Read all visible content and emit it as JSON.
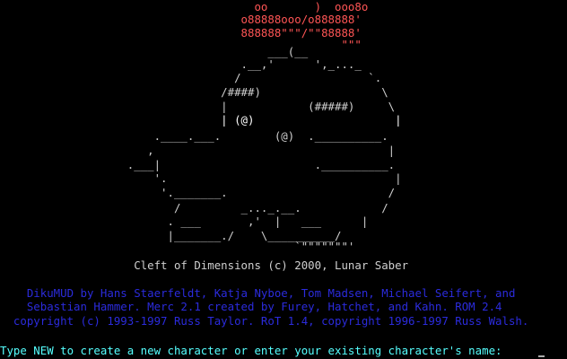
{
  "colors": {
    "background": "#000000",
    "art_top": "#ff5555",
    "art_body": "#cfcfcf",
    "credits": "#2b2bdc",
    "prompt": "#55ffff"
  },
  "art_top": [
    "                                      oo       )  ooo8o",
    "                                    o88888ooo/o888888'",
    "                                    888888\"\"\"/\"\"88888'",
    "                                                   \"\"\""
  ],
  "art_body": [
    "                                        ___(__",
    "                                    .__,'      ',_..._",
    "                                   /                   `.",
    "                                 /####)                  \\",
    "                                 |            (#####)     \\",
    "                                 | (@)                     |",
    "                       .____.___.        (@)  .__________.",
    "                      ,                                   |",
    "                   .___|                       .__________.",
    "                       '.                                  |",
    "                        '._______.                        /",
    "                          /         _..._.__.            /",
    "                         . ___       ,'  |   ___      |",
    "                         |_______./    \\__________/",
    "                                            `\"\"\"\"\"\"\"'"
  ],
  "title_line": "                    Cleft of Dimensions (c) 2000, Lunar Saber",
  "credits": [
    "    DikuMUD by Hans Staerfeldt, Katja Nyboe, Tom Madsen, Michael Seifert, and",
    "    Sebastian Hammer. Merc 2.1 created by Furey, Hatchet, and Kahn. ROM 2.4",
    "  copyright (c) 1993-1997 Russ Taylor. RoT 1.4, copyright 1996-1997 Russ Walsh."
  ],
  "prompt": "Type NEW to create a new character or enter your existing character's name:"
}
